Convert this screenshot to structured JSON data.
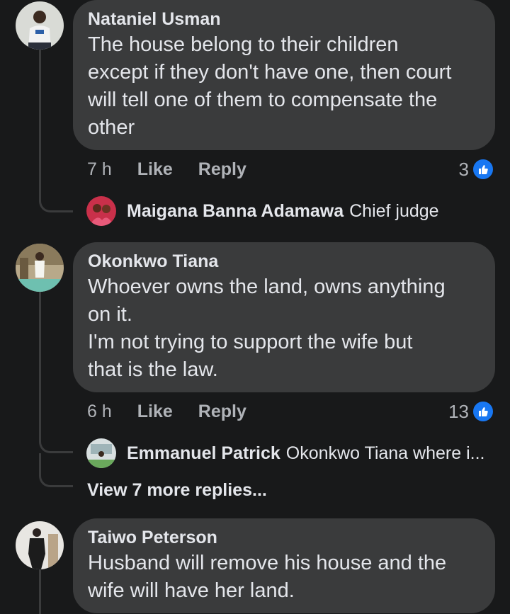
{
  "comments": [
    {
      "author": "Nataniel Usman",
      "text": "The house belong to their children\nexcept if they don't have one, then court\nwill tell one of them to compensate the\nother",
      "time": "7 h",
      "like_label": "Like",
      "reply_label": "Reply",
      "reaction_count": "3",
      "reply": {
        "author": "Maigana Banna Adamawa",
        "text": "Chief judge"
      }
    },
    {
      "author": "Okonkwo Tiana",
      "text": "Whoever owns the land, owns anything\non it.\nI'm not trying to support the wife but\nthat is the law.",
      "time": "6 h",
      "like_label": "Like",
      "reply_label": "Reply",
      "reaction_count": "13",
      "reply": {
        "author": "Emmanuel Patrick",
        "text": "Okonkwo Tiana where i..."
      },
      "view_more": "View 7 more replies..."
    },
    {
      "author": "Taiwo Peterson",
      "text": "Husband will remove his house and the\nwife will have her land."
    }
  ],
  "colors": {
    "background": "#18191a",
    "bubble": "#3a3b3c",
    "primary_text": "#e4e6eb",
    "secondary_text": "#b0b3b8",
    "like_blue": "#1877f2"
  },
  "icons": {
    "reaction": "thumbs-up-icon"
  }
}
